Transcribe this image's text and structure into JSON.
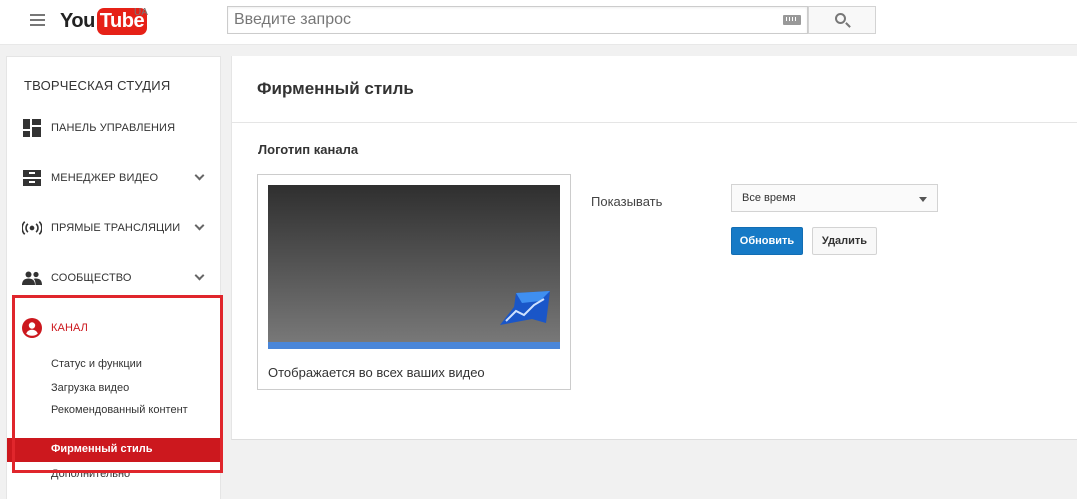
{
  "header": {
    "logo_you": "You",
    "logo_tube": "Tube",
    "region": "UA",
    "search_placeholder": "Введите запрос"
  },
  "sidebar": {
    "title": "ТВОРЧЕСКАЯ СТУДИЯ",
    "items": [
      {
        "label": "ПАНЕЛЬ УПРАВЛЕНИЯ",
        "icon": "dashboard-icon"
      },
      {
        "label": "МЕНЕДЖЕР ВИДЕО",
        "icon": "video-manager-icon"
      },
      {
        "label": "ПРЯМЫЕ ТРАНСЛЯЦИИ",
        "icon": "live-stream-icon"
      },
      {
        "label": "СООБЩЕСТВО",
        "icon": "community-icon"
      },
      {
        "label": "КАНАЛ",
        "icon": "channel-icon"
      }
    ],
    "channel_subitems": [
      "Статус и функции",
      "Загрузка видео",
      "Рекомендованный контент",
      "Фирменный стиль",
      "Дополнительно"
    ],
    "selected_subitem": "Фирменный стиль"
  },
  "main": {
    "title": "Фирменный стиль",
    "section_title": "Логотип канала",
    "card_caption": "Отображается во всех ваших видео",
    "show_label": "Показывать",
    "show_value": "Все время",
    "update_button": "Обновить",
    "delete_button": "Удалить"
  },
  "colors": {
    "accent_red": "#cc181e",
    "highlight_red": "#e0262c",
    "primary_blue": "#167ac6"
  }
}
